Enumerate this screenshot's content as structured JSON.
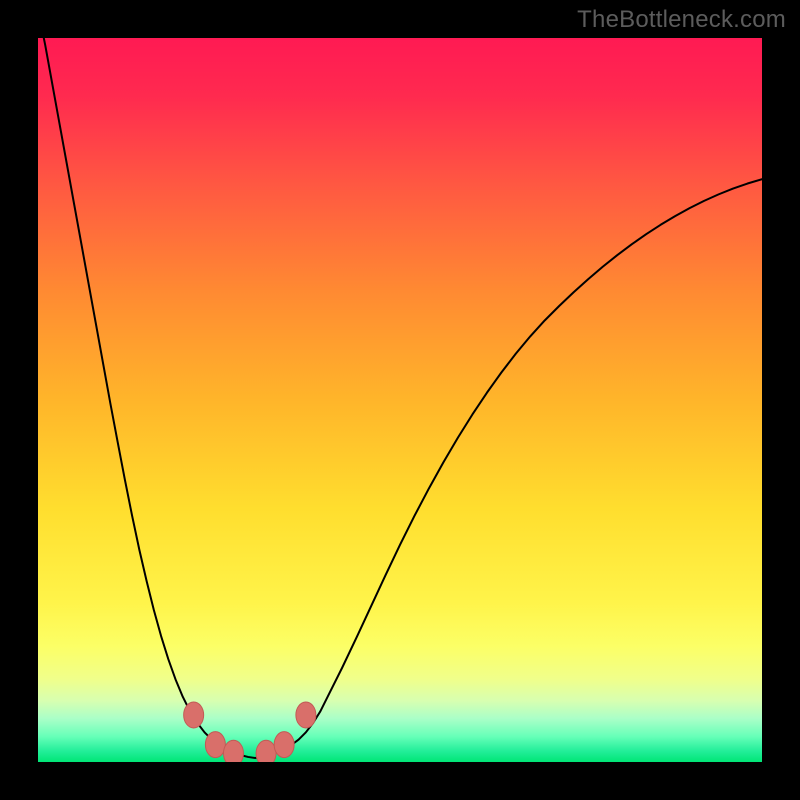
{
  "watermark": "TheBottleneck.com",
  "colors": {
    "frame": "#000000",
    "curve": "#000000",
    "marker_fill": "#d96f6a",
    "marker_stroke": "#c25a55",
    "gradient_stops": [
      {
        "offset": 0.0,
        "color": "#ff1a53"
      },
      {
        "offset": 0.08,
        "color": "#ff2a4f"
      },
      {
        "offset": 0.2,
        "color": "#ff5742"
      },
      {
        "offset": 0.35,
        "color": "#ff8a32"
      },
      {
        "offset": 0.5,
        "color": "#ffb52a"
      },
      {
        "offset": 0.65,
        "color": "#ffde2e"
      },
      {
        "offset": 0.78,
        "color": "#fff44a"
      },
      {
        "offset": 0.84,
        "color": "#fcff66"
      },
      {
        "offset": 0.885,
        "color": "#f0ff8a"
      },
      {
        "offset": 0.915,
        "color": "#d8ffb0"
      },
      {
        "offset": 0.94,
        "color": "#aaffc8"
      },
      {
        "offset": 0.965,
        "color": "#66ffb8"
      },
      {
        "offset": 0.985,
        "color": "#22ee99"
      },
      {
        "offset": 1.0,
        "color": "#00e676"
      }
    ]
  },
  "chart_data": {
    "type": "line",
    "title": "",
    "xlabel": "",
    "ylabel": "",
    "xlim": [
      0,
      100
    ],
    "ylim": [
      0,
      100
    ],
    "x": [
      0,
      1,
      2,
      3,
      4,
      5,
      6,
      7,
      8,
      9,
      10,
      11,
      12,
      13,
      14,
      15,
      16,
      17,
      18,
      19,
      20,
      21,
      22,
      23,
      24,
      25,
      26,
      27,
      28,
      29,
      30,
      31,
      32,
      33,
      34,
      35,
      36,
      37,
      38,
      39,
      40,
      42,
      44,
      46,
      48,
      50,
      52,
      54,
      56,
      58,
      60,
      62,
      64,
      66,
      68,
      70,
      72,
      74,
      76,
      78,
      80,
      82,
      84,
      86,
      88,
      90,
      92,
      94,
      96,
      98,
      100
    ],
    "y": [
      104,
      99,
      93.5,
      88,
      82.5,
      77,
      71.5,
      66,
      60.5,
      55,
      49.5,
      44.2,
      39,
      34,
      29.3,
      25,
      21,
      17.4,
      14.2,
      11.4,
      9,
      7,
      5.4,
      4.1,
      3.1,
      2.35,
      1.75,
      1.3,
      0.95,
      0.7,
      0.55,
      0.7,
      0.95,
      1.3,
      1.75,
      2.35,
      3.1,
      4.1,
      5.4,
      7,
      9,
      13,
      17.2,
      21.5,
      25.8,
      30,
      34,
      37.8,
      41.4,
      44.8,
      48,
      51,
      53.8,
      56.4,
      58.8,
      61,
      63,
      64.9,
      66.7,
      68.4,
      70,
      71.5,
      72.9,
      74.2,
      75.4,
      76.5,
      77.5,
      78.4,
      79.2,
      79.9,
      80.5
    ],
    "markers": [
      {
        "x": 21.5,
        "y": 6.5
      },
      {
        "x": 24.5,
        "y": 2.4
      },
      {
        "x": 27.0,
        "y": 1.2
      },
      {
        "x": 31.5,
        "y": 1.2
      },
      {
        "x": 34.0,
        "y": 2.4
      },
      {
        "x": 37.0,
        "y": 6.5
      }
    ]
  }
}
